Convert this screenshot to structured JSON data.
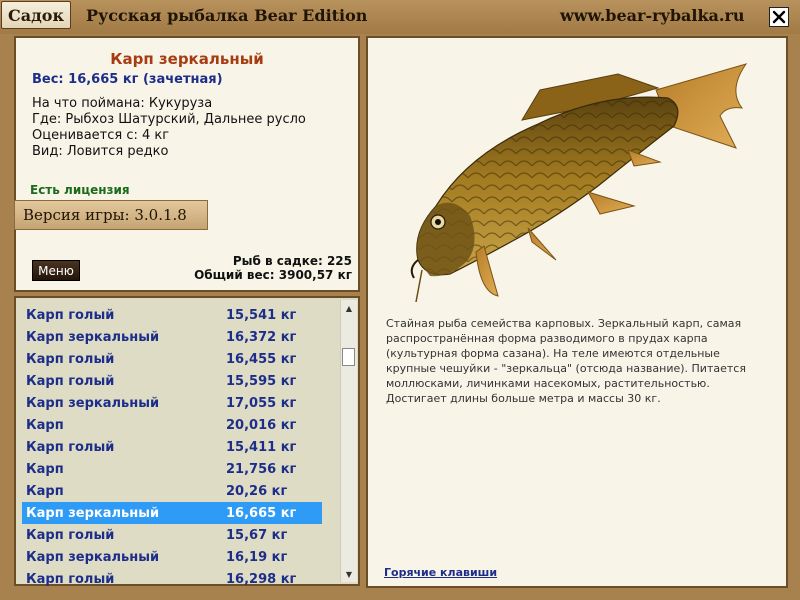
{
  "titlebar": {
    "tab_label": "Садок",
    "app_title": "Русская рыбалка Bear Edition",
    "url": "www.bear-rybalka.ru"
  },
  "info": {
    "fish_name": "Карп зеркальный",
    "weight_line": "Вес: 16,665 кг (зачетная)",
    "bait_line": "На что поймана: Кукуруза",
    "place_line": "Где: Рыбхоз Шатурский, Дальнее русло",
    "value_line": "Оценивается с: 4 кг",
    "kind_line": "Вид: Ловится редко",
    "license": "Есть лицензия",
    "version": "Версия игры: 3.0.1.8",
    "menu_label": "Меню",
    "fish_count": "Рыб в садке: 225",
    "total_weight": "Общий вес: 3900,57 кг"
  },
  "catch_list": [
    {
      "name": "Карп голый",
      "weight": "15,541 кг"
    },
    {
      "name": "Карп зеркальный",
      "weight": "16,372 кг"
    },
    {
      "name": "Карп голый",
      "weight": "16,455 кг"
    },
    {
      "name": "Карп голый",
      "weight": "15,595 кг"
    },
    {
      "name": "Карп зеркальный",
      "weight": "17,055 кг"
    },
    {
      "name": "Карп",
      "weight": "20,016 кг"
    },
    {
      "name": "Карп голый",
      "weight": "15,411 кг"
    },
    {
      "name": "Карп",
      "weight": "21,756 кг"
    },
    {
      "name": "Карп",
      "weight": "20,26 кг"
    },
    {
      "name": "Карп зеркальный",
      "weight": "16,665 кг"
    },
    {
      "name": "Карп голый",
      "weight": "15,67 кг"
    },
    {
      "name": "Карп зеркальный",
      "weight": "16,19 кг"
    },
    {
      "name": "Карп голый",
      "weight": "16,298 кг"
    }
  ],
  "selected_index": 9,
  "description": "Стайная рыба семейства карповых. Зеркальный карп, самая распространённая форма разводимого в прудах карпа (культурная форма сазана). На теле имеются отдельные крупные чешуйки - \"зеркальца\" (отсюда название). Питается моллюсками, личинками насекомых, растительностью. Достигает длины больше метра и массы 30 кг.",
  "hotkeys_link": "Горячие клавиши",
  "icons": {
    "close": "close-icon",
    "scroll_up": "arrow-up-icon",
    "scroll_down": "arrow-down-icon",
    "fish": "carp-fish-image"
  },
  "colors": {
    "frame": "#a7824f",
    "fish_name": "#a63c12",
    "weight_text": "#1c2e8a",
    "license": "#1a6b1a",
    "selection": "#2e9bf6"
  }
}
